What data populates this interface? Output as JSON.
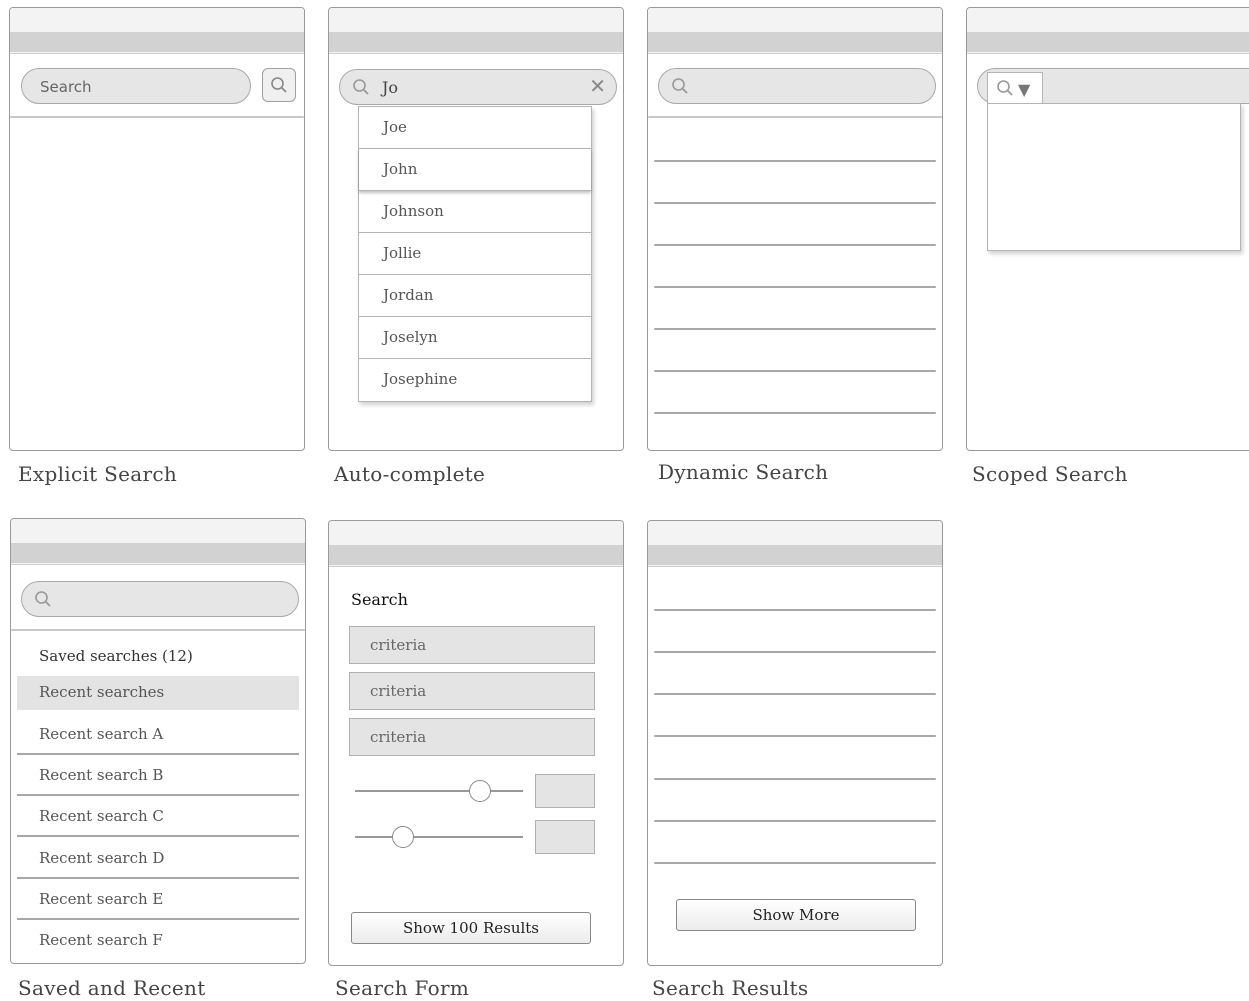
{
  "captions": {
    "explicit": "Explicit Search",
    "autocomplete": "Auto-complete",
    "dynamic": "Dynamic Search",
    "scoped": "Scoped Search",
    "saved": "Saved and Recent",
    "form": "Search Form",
    "results": "Search Results"
  },
  "explicit": {
    "search_placeholder": "Search"
  },
  "autocomplete": {
    "query": "Jo",
    "suggestions": [
      "Joe",
      "John",
      "Johnson",
      "Jollie",
      "Jordan",
      "Joselyn",
      "Josephine"
    ],
    "highlighted": "John"
  },
  "saved": {
    "items": [
      "Saved searches (12)",
      "Recent searches",
      "Recent search A",
      "Recent search B",
      "Recent search C",
      "Recent search D",
      "Recent search E",
      "Recent search F"
    ]
  },
  "form": {
    "heading": "Search",
    "fields": [
      "criteria",
      "criteria",
      "criteria"
    ],
    "sliders": [
      0.78,
      0.25
    ],
    "button_label": "Show 100 Results"
  },
  "results": {
    "button_label": "Show More"
  },
  "icons": [
    "search-icon",
    "clear-icon",
    "scope-dropdown-icon"
  ]
}
